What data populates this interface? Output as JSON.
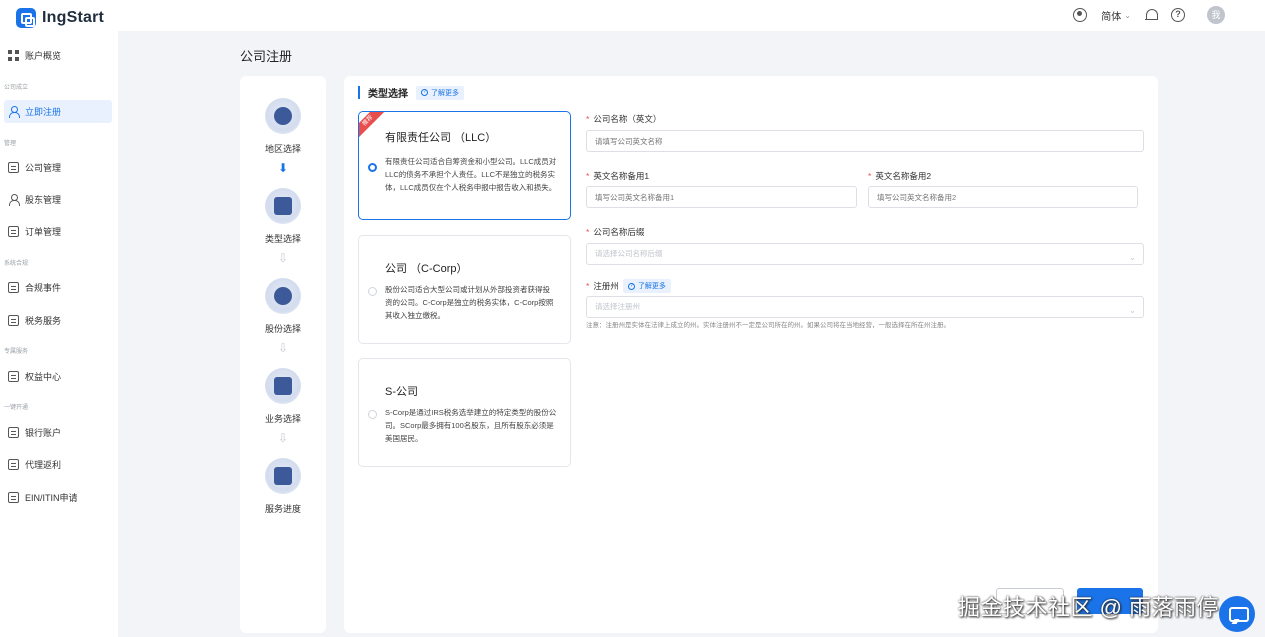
{
  "app": {
    "name": "IngStart"
  },
  "header": {
    "language": "简体",
    "avatar_text": "我"
  },
  "sidebar": {
    "items": [
      {
        "label": "账户概览"
      },
      {
        "label": "立即注册"
      },
      {
        "label": "公司管理"
      },
      {
        "label": "股东管理"
      },
      {
        "label": "订单管理"
      },
      {
        "label": "合规事件"
      },
      {
        "label": "税务服务"
      },
      {
        "label": "权益中心"
      },
      {
        "label": "银行账户"
      },
      {
        "label": "代理返利"
      },
      {
        "label": "EIN/ITIN申请"
      }
    ],
    "sections": [
      "公司成立",
      "管理",
      "系统合规",
      "专属服务",
      "一键开通"
    ]
  },
  "page": {
    "title": "公司注册"
  },
  "steps": [
    {
      "label": "地区选择"
    },
    {
      "label": "类型选择"
    },
    {
      "label": "股份选择"
    },
    {
      "label": "业务选择"
    },
    {
      "label": "服务进度"
    }
  ],
  "type_section": {
    "title": "类型选择",
    "learn_more": "了解更多"
  },
  "cards": [
    {
      "title": "有限责任公司 （LLC）",
      "desc": "有限责任公司适合自筹资金和小型公司。LLC成员对LLC的债务不承担个人责任。LLC不是独立的税务实体，LLC成员仅在个人税务申报中报告收入和损失。",
      "ribbon": "推荐",
      "selected": true
    },
    {
      "title": "公司 （C-Corp）",
      "desc": "股份公司适合大型公司或计划从外部投资者获得投资的公司。C-Corp是独立的税务实体，C-Corp按照其收入独立缴税。",
      "selected": false
    },
    {
      "title": "S-公司",
      "desc": "S-Corp是通过IRS税务选举建立的特定类型的股份公司。SCorp最多拥有100名股东，且所有股东必须是美国居民。",
      "selected": false
    }
  ],
  "form": {
    "company_name": {
      "label": "公司名称（英文）",
      "placeholder": "请填写公司英文名称"
    },
    "alt_name_1": {
      "label": "英文名称备用1",
      "placeholder": "填写公司英文名称备用1"
    },
    "alt_name_2": {
      "label": "英文名称备用2",
      "placeholder": "填写公司英文名称备用2"
    },
    "suffix": {
      "label": "公司名称后缀",
      "placeholder": "请选择公司名称后缀"
    },
    "state": {
      "label": "注册州",
      "learn_more": "了解更多",
      "placeholder": "请选择注册州"
    },
    "note": "注意：注册州是实体在法律上成立的州。实体注册州不一定是公司所在的州。如果公司将在当地经营，一般选择在所在州注册。"
  },
  "watermark": "掘金技术社区 @ 雨落雨停"
}
